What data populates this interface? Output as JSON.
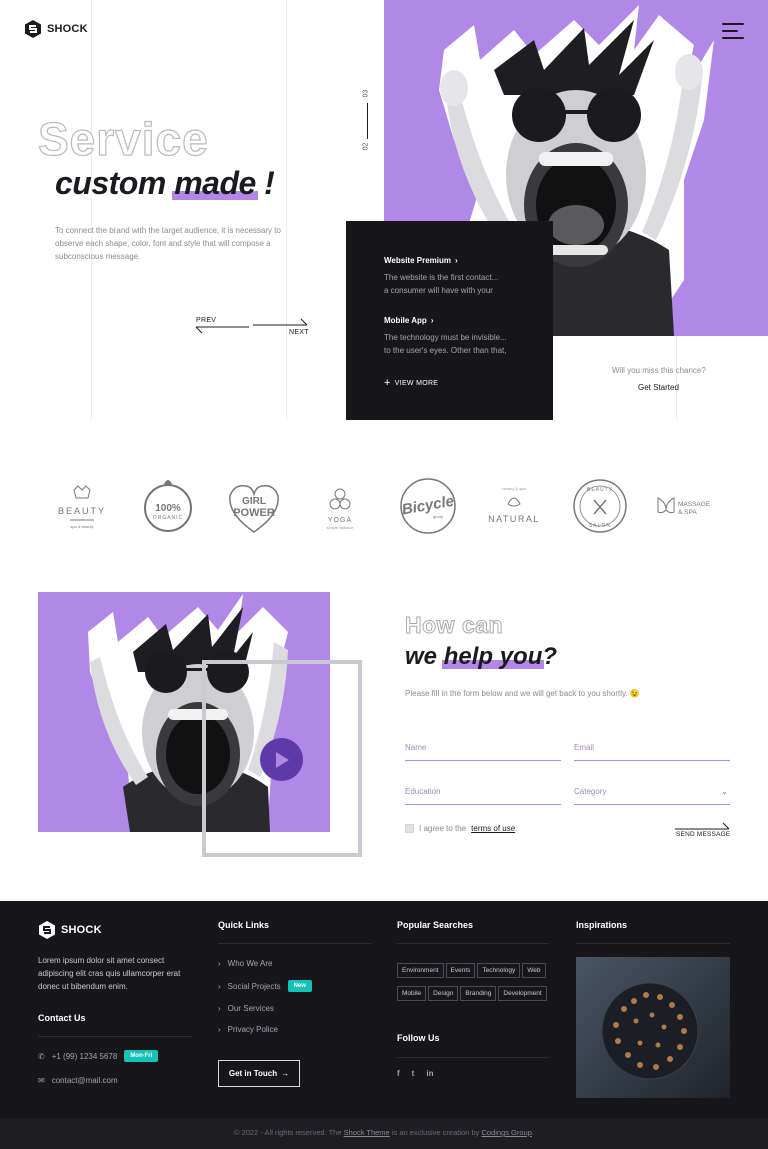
{
  "brand": {
    "name": "SHOCK"
  },
  "hero": {
    "outline": "Service",
    "title_a": "custom ",
    "title_hl": "made",
    "title_b": " !",
    "description": "To connect the brand with the target audience, it is necessary to observe each shape, color, font and style that will compose a subconscious message.",
    "slide_next_num": "03",
    "slide_cur_num": "02",
    "prev_label": "PREV",
    "next_label": "NEXT",
    "cta_question": "Will you miss this chance?",
    "cta_label": "Get Started"
  },
  "services": {
    "items": [
      {
        "title": "Website Premium",
        "text1": "The website is the first contact...",
        "text2": "a consumer will have with your"
      },
      {
        "title": "Mobile App",
        "text1": "The technology must be invisible...",
        "text2": "to the user's eyes. Other than that,"
      }
    ],
    "view_more": "VIEW MORE"
  },
  "brands": [
    {
      "name": "BEAUTY",
      "sub": "spa & beauty"
    },
    {
      "name": "100%",
      "sub": "ORGANIC"
    },
    {
      "name": "GIRL",
      "sub": "POWER"
    },
    {
      "name": "YOGA",
      "sub": "simple balance"
    },
    {
      "name": "Bicycle",
      "sub": "group"
    },
    {
      "name": "NATURAL",
      "sub": "beauty & spa"
    },
    {
      "name": "BEAUTY",
      "sub": "SALON"
    },
    {
      "name": "MASSAGE",
      "sub": "& SPA"
    }
  ],
  "contact": {
    "outline": "How can",
    "title_a": "we ",
    "title_hl": "help you",
    "title_b": "?",
    "subtitle": "Please fill in the form below and we will get back to you shortly. 😉",
    "name_ph": "Name",
    "email_ph": "Email",
    "education_ph": "Education",
    "category_ph": "Category",
    "agree_a": "I agree to the",
    "agree_link": "terms of use",
    "agree_b": ".",
    "send_label": "SEND MESSAGE"
  },
  "footer": {
    "about": "Lorem ipsum dolor sit amet consect adipiscing elit cras quis ullamcorper erat donec ut bibendum enim.",
    "contact_head": "Contact Us",
    "phone": "+1 (99) 1234 5678",
    "phone_badge": "Mon-Fri",
    "email": "contact@mail.com",
    "quick_head": "Quick Links",
    "quick_links": [
      "Who We Are",
      "Social Projects",
      "Our Services",
      "Privacy Police"
    ],
    "new_badge": "New",
    "get_in_touch": "Get in Touch",
    "popular_head": "Popular Searches",
    "tags": [
      "Environment",
      "Events",
      "Technology",
      "Web",
      "Mobile",
      "Design",
      "Branding",
      "Development"
    ],
    "follow_head": "Follow Us",
    "social": [
      "f",
      "t",
      "in"
    ],
    "insp_head": "Inspirations",
    "copy_a": "© 2022 - All rights reserved. The ",
    "copy_link1": "Shock Theme",
    "copy_b": " is an exclusive creation by ",
    "copy_link2": "Codings Group",
    "copy_c": "."
  },
  "colors": {
    "accent": "#b187e8",
    "dark": "#17171b",
    "teal": "#14c2b8"
  }
}
